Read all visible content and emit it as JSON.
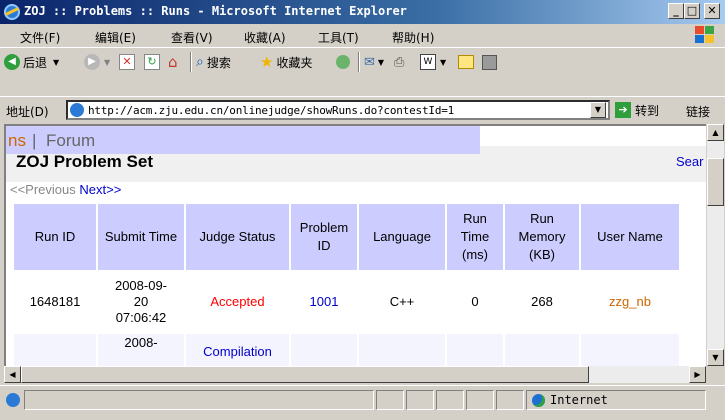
{
  "window": {
    "title": "ZOJ :: Problems :: Runs - Microsoft Internet Explorer",
    "min_label": "_",
    "max_label": "□",
    "close_label": "✕"
  },
  "menu": [
    "文件(F)",
    "编辑(E)",
    "查看(V)",
    "收藏(A)",
    "工具(T)",
    "帮助(H)"
  ],
  "toolbar": {
    "back_label": "后退",
    "search_label": "搜索",
    "favorites_label": "收藏夹"
  },
  "address": {
    "label": "地址(D)",
    "url": "http://acm.zju.edu.cn/onlinejudge/showRuns.do?contestId=1",
    "go_label": "转到",
    "links_label": "链接"
  },
  "page": {
    "nav_fragment": "ns",
    "nav_separator": "|",
    "nav_forum": "Forum",
    "heading": "ZOJ Problem Set",
    "search_link": "Sear",
    "prev_link": "<<Previous",
    "next_link": "Next>>",
    "columns": [
      "Run ID",
      "Submit Time",
      "Judge Status",
      "Problem ID",
      "Language",
      "Run Time (ms)",
      "Run Memory (KB)",
      "User Name"
    ],
    "rows": [
      {
        "run_id": "1648181",
        "submit_time": "2008-09-20 07:06:42",
        "status": "Accepted",
        "problem_id": "1001",
        "language": "C++",
        "run_time": "0",
        "memory": "268",
        "user": "zzg_nb"
      },
      {
        "run_id": "",
        "submit_time": "2008-",
        "status": "Compilation",
        "problem_id": "",
        "language": "",
        "run_time": "",
        "memory": "",
        "user": ""
      }
    ]
  },
  "status": {
    "zone": "Internet"
  },
  "colors": {
    "accepted": "#ff0000",
    "link": "#0000cc",
    "user": "#cc6600",
    "header_bg": "#ccccff"
  }
}
